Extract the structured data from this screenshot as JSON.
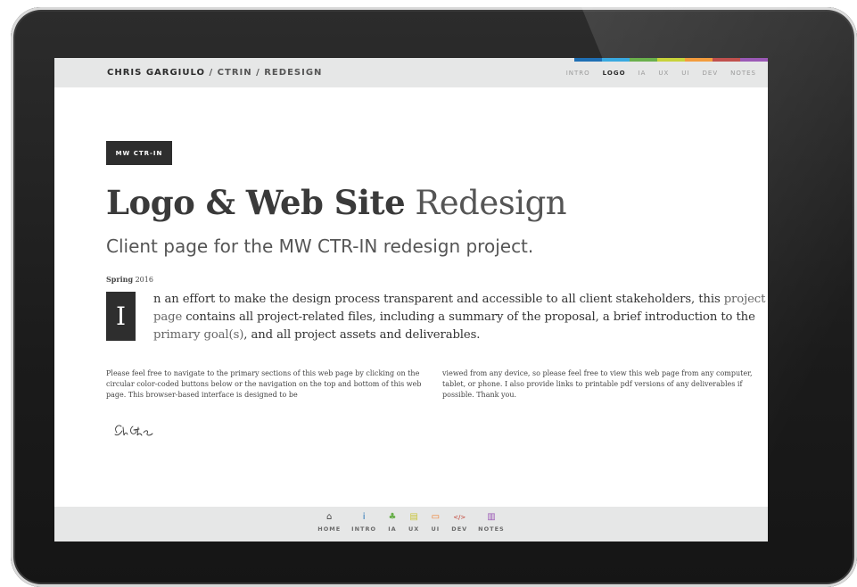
{
  "header": {
    "brand_name": "CHRIS GARGIULO",
    "separator": "/",
    "crumb1": "CTRIN",
    "crumb2": "REDESIGN",
    "nav": [
      "INTRO",
      "LOGO",
      "IA",
      "UX",
      "UI",
      "DEV",
      "NOTES"
    ],
    "active_nav": "LOGO",
    "strip_colors": [
      "#1f6fb4",
      "#39a9e0",
      "#6ab04c",
      "#c8d33a",
      "#f39c3d",
      "#c0504d",
      "#9b59b6"
    ]
  },
  "content": {
    "badge": "MW CTR-IN",
    "title_bold": "Logo & Web Site",
    "title_light": "Redesign",
    "subtitle": "Client page for the MW CTR-IN redesign project.",
    "season_label": "Spring",
    "season_year": "2016",
    "dropcap": "I",
    "intro_part1": "n an effort to make the design process transparent and accessible to all client stakeholders, this ",
    "intro_hl1": "project page",
    "intro_part2": " contains all project-related files, including a summary of the proposal, a brief introduction to the ",
    "intro_hl2": "primary goal(s)",
    "intro_part3": ", and all project assets and deliverables.",
    "col_left": "Please feel free to navigate to the primary sections of this web page by clicking on the circular color-coded buttons below or the navigation on the top and bottom of this web page. This browser-based interface is designed to be",
    "col_right": "viewed from any device, so please feel free to view this web page from any computer, tablet, or phone. I also provide links to printable pdf versions of any deliverables if possible. Thank you."
  },
  "footer": {
    "items": [
      {
        "label": "HOME",
        "icon": "home-icon",
        "glyph": "⌂",
        "color": "#444444"
      },
      {
        "label": "INTRO",
        "icon": "info-icon",
        "glyph": "i",
        "color": "#1f6fb4"
      },
      {
        "label": "IA",
        "icon": "sitemap-icon",
        "glyph": "♣",
        "color": "#6ab04c"
      },
      {
        "label": "UX",
        "icon": "document-icon",
        "glyph": "▤",
        "color": "#c8c43a"
      },
      {
        "label": "UI",
        "icon": "window-icon",
        "glyph": "▭",
        "color": "#f07c2a"
      },
      {
        "label": "DEV",
        "icon": "code-icon",
        "glyph": "</>",
        "color": "#c0392b"
      },
      {
        "label": "NOTES",
        "icon": "clipboard-icon",
        "glyph": "▥",
        "color": "#9b59b6"
      }
    ]
  }
}
